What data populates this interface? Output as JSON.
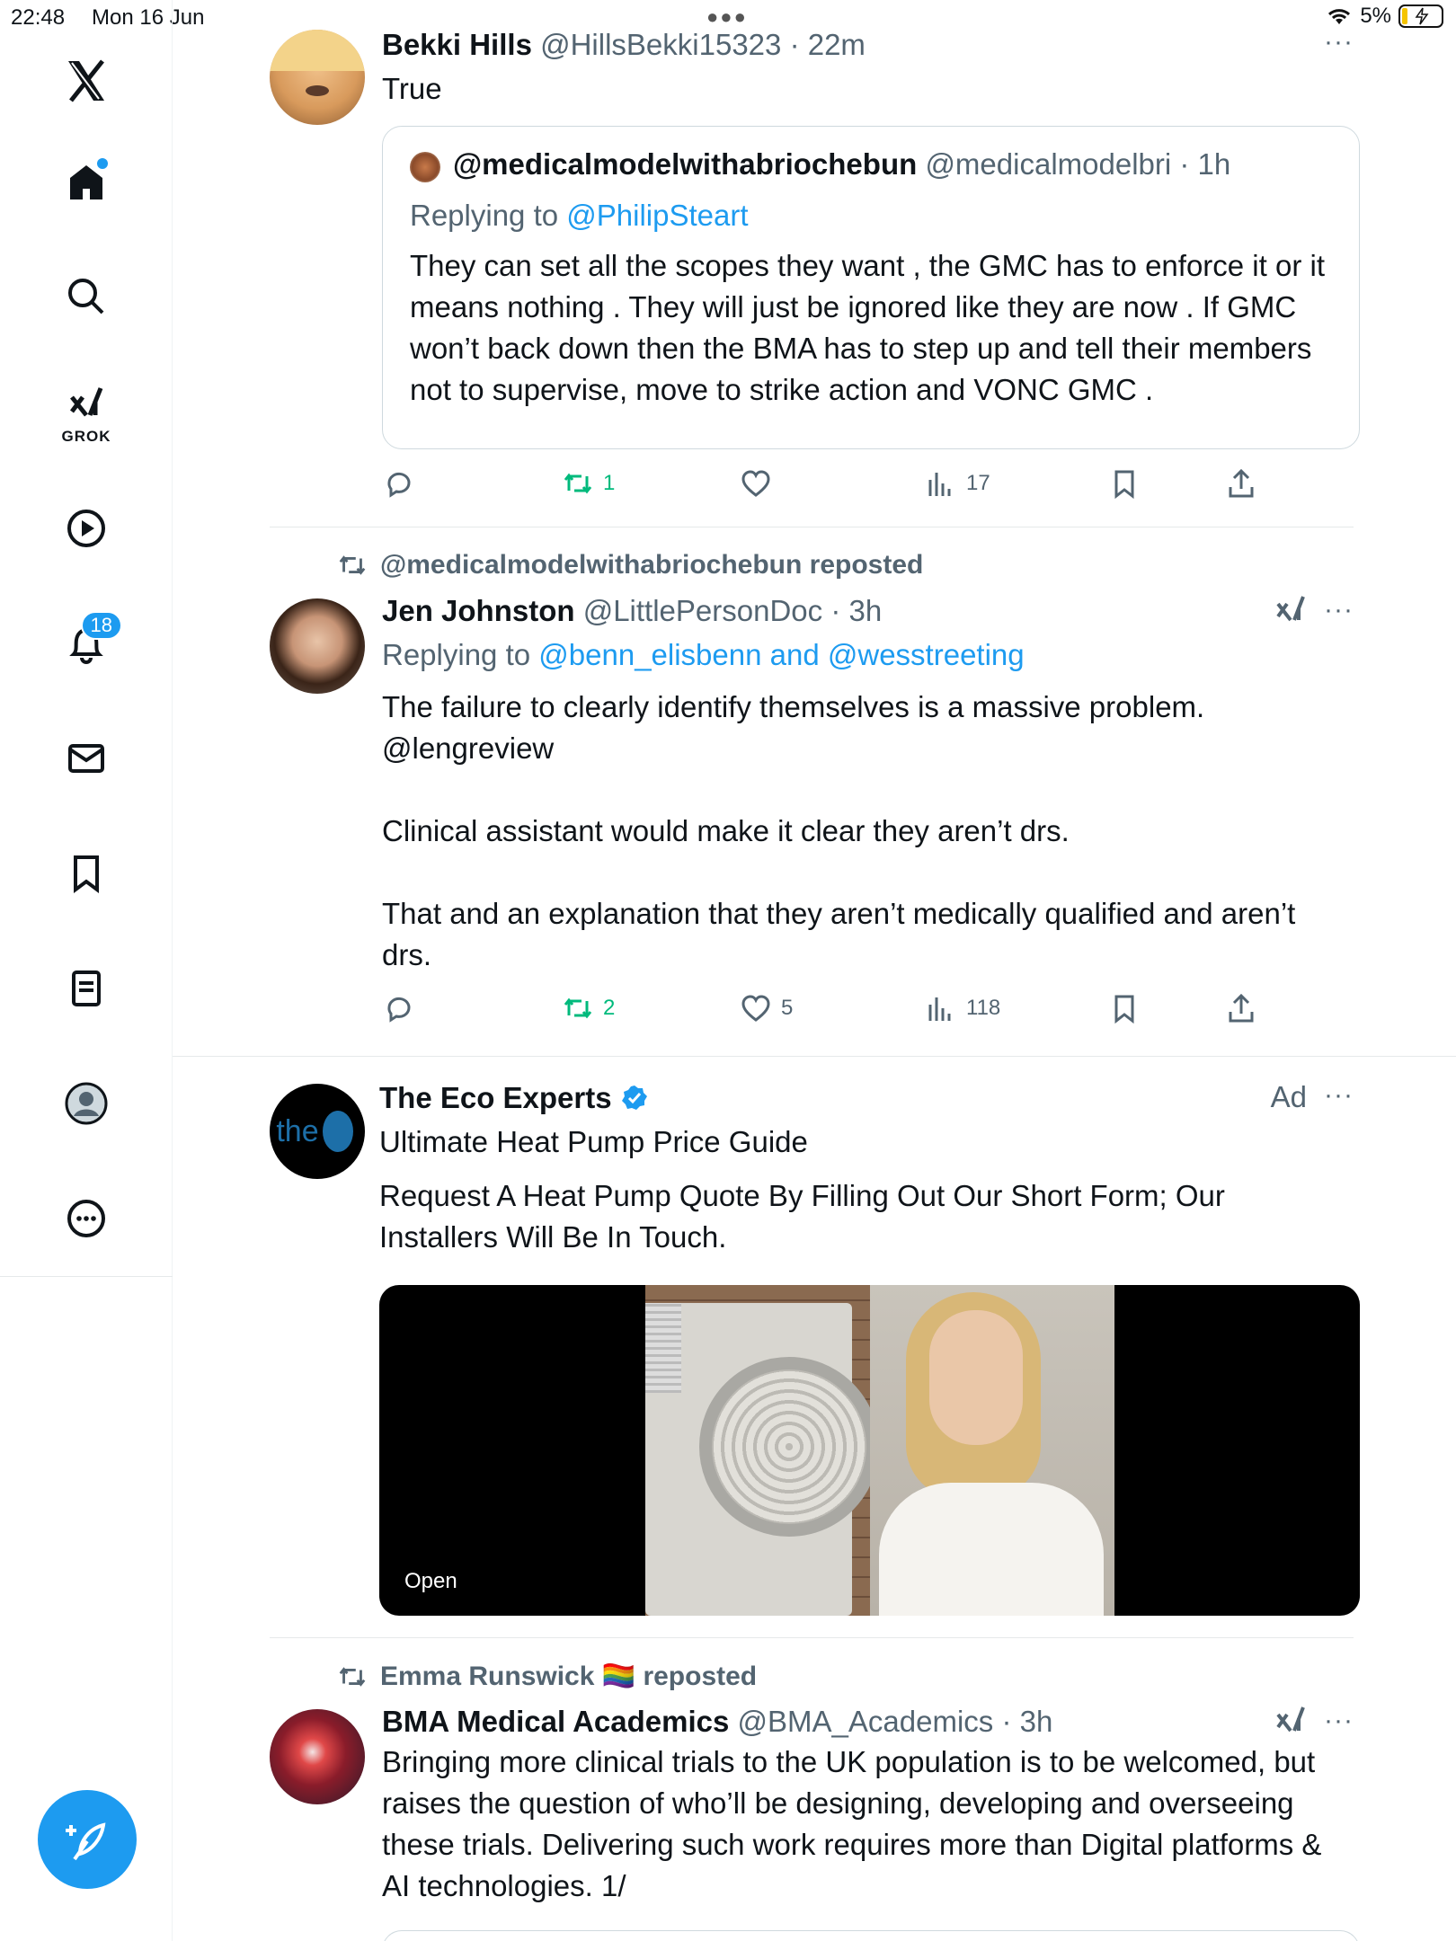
{
  "status_bar": {
    "time": "22:48",
    "date": "Mon 16 Jun",
    "battery": "5%"
  },
  "sidebar": {
    "grok_label": "GROK",
    "notification_count": "18"
  },
  "tweets": [
    {
      "name": "Bekki Hills",
      "handle": "@HillsBekki15323",
      "time": "· 22m",
      "text": "True",
      "quote": {
        "name": "@medicalmodelwithabriochebun",
        "handle": "@medicalmodelbri",
        "time": "· 1h",
        "replying_prefix": "Replying to",
        "replying_to": "@PhilipSteart",
        "text": "They can set all the scopes they want , the GMC has to enforce it or it means nothing . They will just be ignored like they are now . If GMC won’t back down then the BMA has to step up and tell their members not to supervise, move to strike action and VONC GMC ."
      },
      "reposts": "1",
      "likes": "",
      "views": "17"
    },
    {
      "repost_by": "@medicalmodelwithabriochebun reposted",
      "name": "Jen Johnston",
      "handle": "@LittlePersonDoc",
      "time": "· 3h",
      "replying_prefix": "Replying to",
      "replying_to": "@benn_elisbenn and @wesstreeting",
      "text_line1": "The failure to clearly identify themselves is a massive problem.",
      "mention": "@lengreview",
      "text_p2": "Clinical assistant would make it clear they aren’t drs.",
      "text_p3": "That and an explanation that they aren’t medically qualified and aren’t drs.",
      "reposts": "2",
      "likes": "5",
      "views": "118"
    },
    {
      "name": "The Eco Experts",
      "avatar_text": "the",
      "ad_label": "Ad",
      "headline": "Ultimate Heat Pump Price Guide",
      "text": "Request A Heat Pump Quote By Filling Out Our Short Form; Our Installers Will Be In Touch.",
      "open_label": "Open"
    },
    {
      "repost_by": "Emma Runswick 🏳️‍🌈 reposted",
      "name": "BMA Medical Academics",
      "handle": "@BMA_Academics",
      "time": "· 3h",
      "text": "Bringing more clinical trials to the UK population is to be welcomed, but raises the question of who’ll be designing, developing and overseeing these trials. Delivering such work requires more than Digital platforms & AI technologies. 1/"
    }
  ],
  "colors": {
    "accent": "#1d9bf0",
    "repost_green": "#00ba7c",
    "muted": "#536471"
  },
  "icons": [
    "x-logo-icon",
    "home-icon",
    "search-icon",
    "grok-icon",
    "video-icon",
    "bell-icon",
    "mail-icon",
    "bookmark-icon",
    "list-icon",
    "profile-icon",
    "more-icon",
    "compose-icon",
    "reply-icon",
    "repost-icon",
    "like-icon",
    "views-icon",
    "share-icon",
    "verified-icon"
  ]
}
